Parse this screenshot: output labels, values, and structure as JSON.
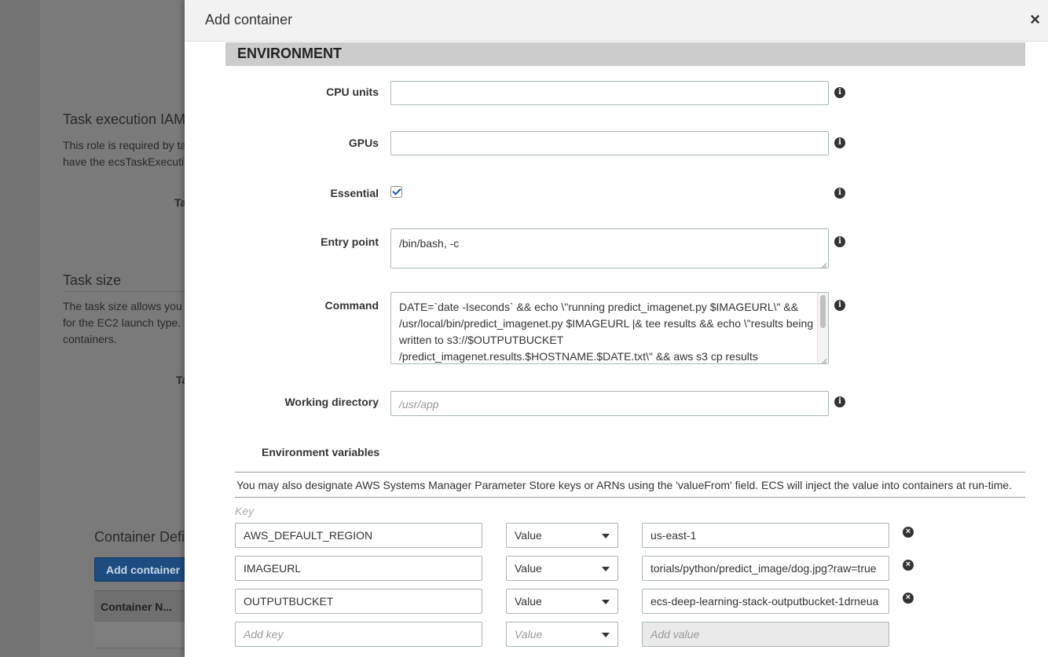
{
  "background": {
    "task_exec_heading": "Task execution IAM",
    "task_exec_line1": "This role is required by ta",
    "task_exec_line2": "have the ecsTaskExecuti",
    "task_exec_field_label": "Ta",
    "task_size_heading": "Task size",
    "task_size_line1": "The task size allows you",
    "task_size_line2": "for the EC2 launch type.",
    "task_size_line3": "containers.",
    "task_size_field_label": "Ta",
    "container_defs_heading": "Container Defi",
    "add_container_button": "Add container",
    "table_header_container_name": "Container N..."
  },
  "modal": {
    "title": "Add container",
    "close_glyph": "×",
    "section_title": "ENVIRONMENT",
    "cpu_units": {
      "label": "CPU units",
      "value": ""
    },
    "gpus": {
      "label": "GPUs",
      "value": ""
    },
    "essential": {
      "label": "Essential",
      "checked": true
    },
    "entry_point": {
      "label": "Entry point",
      "value": "/bin/bash, -c"
    },
    "command": {
      "label": "Command",
      "value": "DATE=`date -Iseconds` && echo \\\"running predict_imagenet.py $IMAGEURL\\\" && /usr/local/bin/predict_imagenet.py $IMAGEURL |& tee results && echo \\\"results being written to s3://$OUTPUTBUCKET /predict_imagenet.results.$HOSTNAME.$DATE.txt\\\" && aws s3 cp results"
    },
    "working_directory": {
      "label": "Working directory",
      "placeholder": "/usr/app",
      "value": ""
    },
    "info_glyph": "i",
    "env_vars": {
      "label": "Environment variables",
      "note": "You may also designate AWS Systems Manager Parameter Store keys or ARNs using the 'valueFrom' field. ECS will inject the value into containers at run-time.",
      "key_header": "Key",
      "remove_glyph": "×",
      "rows": [
        {
          "key": "AWS_DEFAULT_REGION",
          "type": "Value",
          "value": "us-east-1"
        },
        {
          "key": "IMAGEURL",
          "type": "Value",
          "value": "torials/python/predict_image/dog.jpg?raw=true"
        },
        {
          "key": "OUTPUTBUCKET",
          "type": "Value",
          "value": "ecs-deep-learning-stack-outputbucket-1drneua"
        }
      ],
      "new_row": {
        "key_placeholder": "Add key",
        "type_placeholder": "Value",
        "value_placeholder": "Add value"
      }
    }
  },
  "colors": {
    "primary_button": "#1c4c80",
    "checkbox_check": "#1a56a8",
    "section_bar": "#cccccc"
  }
}
